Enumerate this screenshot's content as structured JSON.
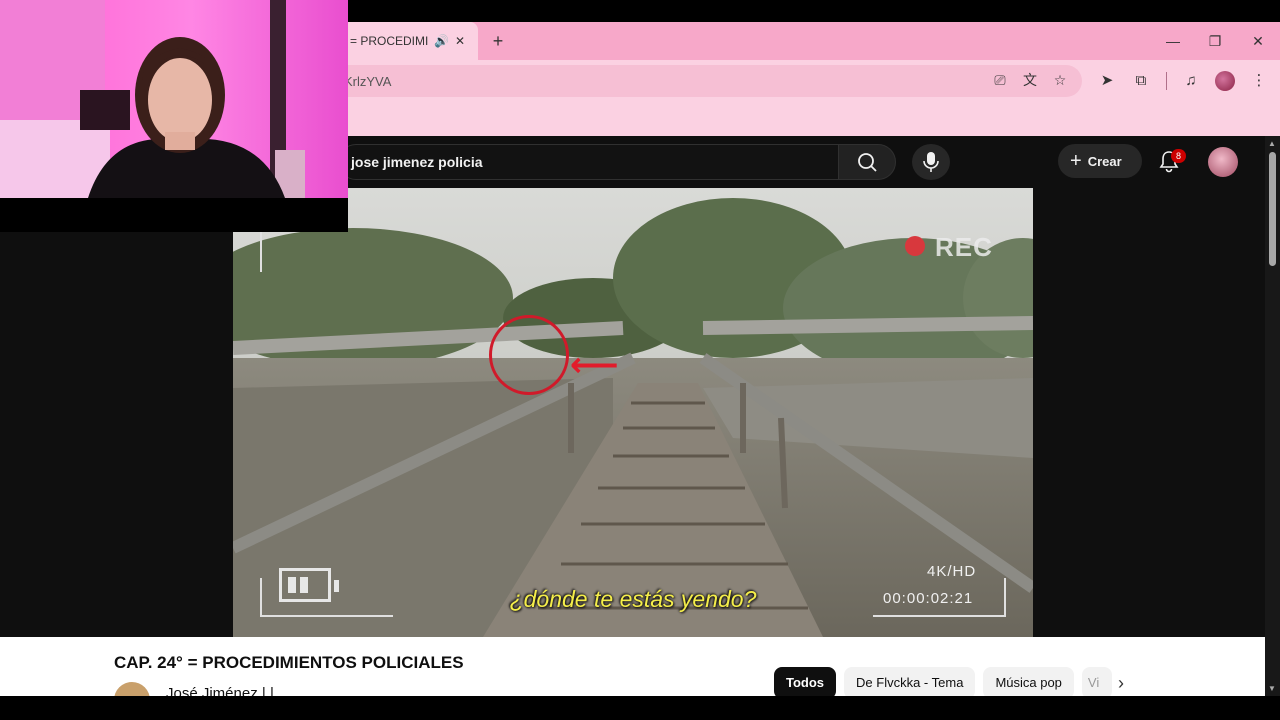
{
  "browser": {
    "tab_title": "= PROCEDIMIENTOS POLICIALES",
    "url_partial": "KrlzYVA",
    "new_tab_label": "+",
    "window_controls": {
      "minimize": "—",
      "maximize": "❐",
      "close": "✕"
    }
  },
  "youtube": {
    "search_query": "jose jimenez policia",
    "create_label": "Crear",
    "notification_count": "8"
  },
  "video": {
    "subtitle": "¿dónde te estás yendo?",
    "rec_label": "REC",
    "quality_label": "4K/HD",
    "timecode": "00:00:02:21"
  },
  "below_video": {
    "title": "CAP. 24° = PROCEDIMIENTOS POLICIALES",
    "channel_name": "José Jiménez | |",
    "chips": [
      "Todos",
      "De Flvckka - Tema",
      "Música pop",
      "Vi"
    ]
  },
  "icons": {
    "speaker": "speaker-icon",
    "search": "search-icon",
    "mic": "microphone-icon",
    "bell": "bell-icon"
  }
}
